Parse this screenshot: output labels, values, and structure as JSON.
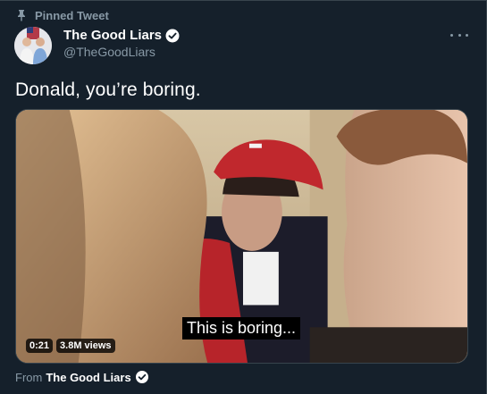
{
  "pinned": {
    "label": "Pinned Tweet",
    "icon": "pin-icon"
  },
  "author": {
    "name": "The Good Liars",
    "handle": "@TheGoodLiars",
    "verified_icon": "verified-badge-icon"
  },
  "more_icon": "more-options-icon",
  "tweet": {
    "text": "Donald, you’re boring."
  },
  "media": {
    "caption": "This is boring...",
    "duration": "0:21",
    "views": "3.8M views"
  },
  "source": {
    "prefix": "From",
    "name": "The Good Liars"
  },
  "colors": {
    "background": "#15202b",
    "secondary_text": "#8899a6",
    "border": "#38444d",
    "hat_red": "#c0282d"
  }
}
